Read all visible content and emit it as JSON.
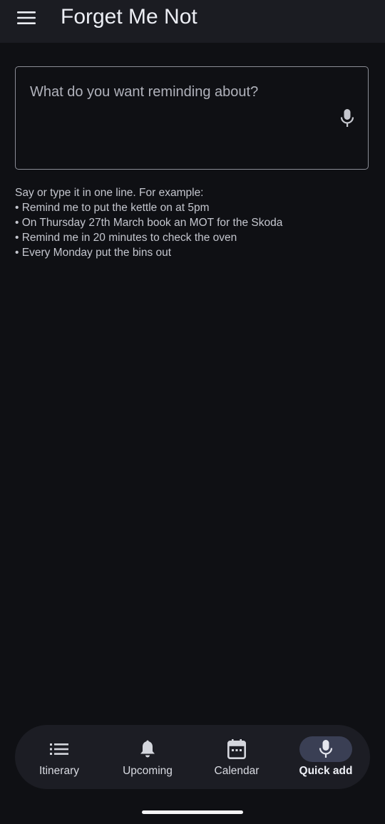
{
  "app": {
    "title": "Forget Me Not"
  },
  "input": {
    "placeholder": "What do you want reminding about?"
  },
  "help": {
    "intro": "Say or type it in one line. For example:",
    "examples": [
      "• Remind me to put the kettle on at 5pm",
      "• On Thursday 27th March book an MOT for the Skoda",
      "• Remind me in 20 minutes to check the oven",
      "• Every Monday put the bins out"
    ]
  },
  "nav": {
    "items": [
      {
        "label": "Itinerary",
        "icon": "list-icon",
        "active": false
      },
      {
        "label": "Upcoming",
        "icon": "bell-icon",
        "active": false
      },
      {
        "label": "Calendar",
        "icon": "calendar-icon",
        "active": false
      },
      {
        "label": "Quick add",
        "icon": "mic-icon",
        "active": true
      }
    ]
  },
  "colors": {
    "background": "#0f1014",
    "appbar": "#1b1c22",
    "navbar": "#1c1d24",
    "active_pill": "#3a3f54",
    "icon": "#d4d6dd"
  }
}
